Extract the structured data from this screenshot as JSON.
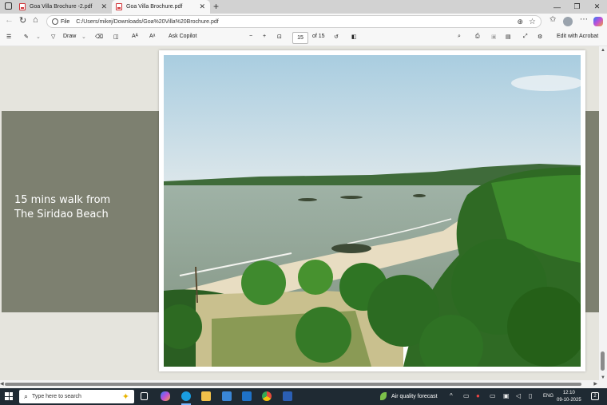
{
  "browser": {
    "tabs": [
      {
        "label": "Goa Villa Brochure -2.pdf",
        "active": false
      },
      {
        "label": "Goa Villa Brochure.pdf",
        "active": true
      }
    ],
    "address": {
      "scheme_label": "File",
      "url": "C:/Users/mikej/Downloads/Goa%20Villa%20Brochure.pdf"
    }
  },
  "pdf_toolbar": {
    "draw_label": "Draw",
    "ask_copilot_label": "Ask Copilot",
    "current_page": "15",
    "page_total": "of 15",
    "edit_with_acrobat_label": "Edit with Acrobat"
  },
  "document": {
    "caption_line1": "15 mins walk from",
    "caption_line2": "The Siridao Beach",
    "colors": {
      "band": "#7d8070",
      "page_bg": "#e5e4dd"
    }
  },
  "taskbar": {
    "search_placeholder": "Type here to search",
    "weather_label": "Air quality forecast",
    "language": "ENG",
    "time": "12:10",
    "date": "09-10-2025",
    "notification_count": "2"
  }
}
